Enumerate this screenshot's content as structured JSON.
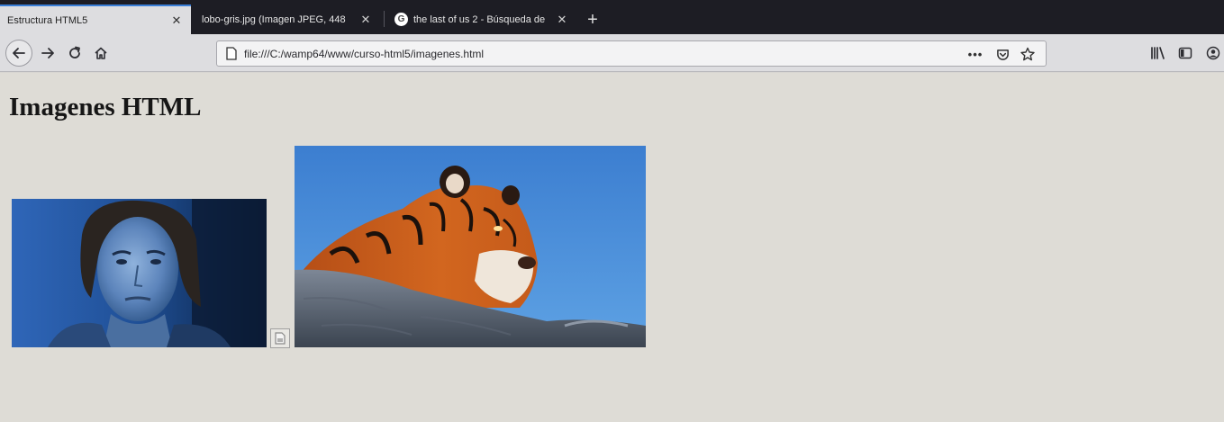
{
  "tabs": [
    {
      "title": "Estructura HTML5",
      "active": true
    },
    {
      "title": "lobo-gris.jpg (Imagen JPEG, 448",
      "active": false
    },
    {
      "title": "the last of us 2 - Búsqueda de",
      "active": false,
      "favicon": "G"
    }
  ],
  "toolbar": {
    "url": "file:///C:/wamp64/www/curso-html5/imagenes.html",
    "more_label": "•••"
  },
  "page": {
    "heading": "Imagenes HTML"
  },
  "colors": {
    "accent": "#3a7fd8",
    "tabstrip": "#1d1d24",
    "content_bg": "#dedcd6"
  }
}
